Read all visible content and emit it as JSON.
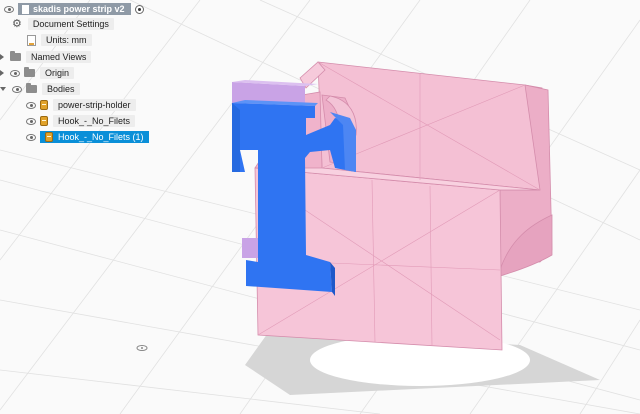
{
  "browser": {
    "document_title": "skadis power strip v2",
    "document_settings": "Document Settings",
    "units": "Units: mm",
    "named_views": "Named Views",
    "origin": "Origin",
    "bodies": "Bodies",
    "body_items": [
      {
        "label": "power-strip-holder"
      },
      {
        "label": "Hook_-_No_Filets"
      },
      {
        "label": "Hook_-_No_Filets (1)",
        "selected": true
      }
    ]
  },
  "colors": {
    "body_pink": "#f2b9cf",
    "body_edge": "#d48cab",
    "hook_blue": "#2f74f2",
    "selection": "#0a8fd8",
    "hook_purple": "#c9a3e6"
  }
}
